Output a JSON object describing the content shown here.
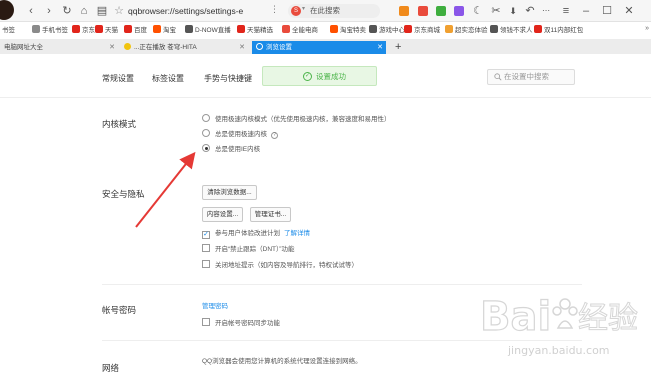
{
  "toolbar": {
    "address": "qqbrowser://settings/settings-e",
    "address_end": "⋮",
    "search_placeholder": "在此搜索"
  },
  "bookmarks": [
    {
      "label": "书签",
      "color": "#ffffff"
    },
    {
      "label": "手机书签",
      "color": "#8a8a8a"
    },
    {
      "label": "京东",
      "color": "#e1251b"
    },
    {
      "label": "天猫",
      "color": "#e1251b"
    },
    {
      "label": "百度",
      "color": "#e1251b"
    },
    {
      "label": "淘宝",
      "color": "#ff5000"
    },
    {
      "label": "D-NOW直播",
      "color": "#555555"
    },
    {
      "label": "天猫精选",
      "color": "#e1251b"
    },
    {
      "label": "全能电商",
      "color": "#e94b3c"
    },
    {
      "label": "淘宝特卖",
      "color": "#ff5000"
    },
    {
      "label": "游戏中心",
      "color": "#555555"
    },
    {
      "label": "京东商城",
      "color": "#e1251b"
    },
    {
      "label": "超实恋体验",
      "color": "#f0a030"
    },
    {
      "label": "领钱不求人",
      "color": "#555555"
    },
    {
      "label": "双11内部红包",
      "color": "#e1251b"
    },
    {
      "label": "»",
      "color": "#ffffff"
    }
  ],
  "tabs": [
    {
      "label": "电脑网址大全"
    },
    {
      "label": "...正在播放 苍穹-HITA"
    },
    {
      "label": "浏览设置"
    }
  ],
  "nav": {
    "items": [
      "常规设置",
      "标签设置",
      "手势与快捷键"
    ],
    "toast": "设置成功",
    "search_placeholder": "在设置中搜索"
  },
  "kernel": {
    "title": "内核模式",
    "options": [
      {
        "label": "使用极速内核模式（优先使用极速内核，兼容速度和易用性）",
        "selected": false
      },
      {
        "label": "总是使用极速内核",
        "selected": false
      },
      {
        "label": "总是使用IE内核",
        "selected": true
      }
    ]
  },
  "privacy": {
    "title": "安全与隐私",
    "clear_button": "清除浏览数据...",
    "content_button": "内容设置...",
    "cert_button": "管理证书...",
    "checks": [
      {
        "label": "参与用户体验改进计划",
        "link": "了解详情",
        "checked": true
      },
      {
        "label": "开启“禁止跟踪（DNT）”功能",
        "checked": false
      },
      {
        "label": "关闭地址提示（如内容及导航排行，特权试试等）",
        "checked": false
      }
    ]
  },
  "account": {
    "title": "帐号密码",
    "manage_link": "管理密码",
    "sync_label": "开启帐号密码同步功能"
  },
  "network": {
    "title": "网络",
    "desc": "QQ浏览器会使用您计算机的系统代理设置连接到网络。"
  },
  "watermark": {
    "brand": "Bai",
    "brand_suffix": "经验",
    "url": "jingyan.baidu.com"
  },
  "colors": {
    "accent": "#1a8be8",
    "arrow": "#e53935",
    "success": "#4cb44a"
  }
}
